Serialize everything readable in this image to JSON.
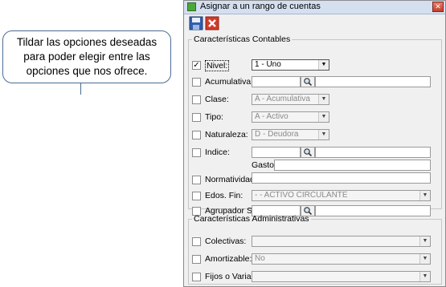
{
  "callout": {
    "text": "Tildar las opciones deseadas para poder elegir entre las opciones que nos ofrece."
  },
  "window": {
    "title": "Asignar a un rango de cuentas"
  },
  "contables": {
    "legend": "Características Contables",
    "nivel": {
      "label": "Nivel:",
      "checked": true,
      "value": "1 - Uno"
    },
    "acumulativa": {
      "label": "Acumulativa:"
    },
    "clase": {
      "label": "Clase:",
      "value": "A - Acumulativa"
    },
    "tipo": {
      "label": "Tipo:",
      "value": "A - Activo"
    },
    "naturaleza": {
      "label": "Naturaleza:",
      "value": "D - Deudora"
    },
    "indice": {
      "label": "Indice:",
      "gasto_label": "Gasto:"
    },
    "normatividad": {
      "label": "Normatividad:"
    },
    "edos_fin": {
      "label": "Edos. Fin:",
      "value": "- - ACTIVO CIRCULANTE"
    },
    "agrupador": {
      "label": "Agrupador SAT:"
    }
  },
  "administrativas": {
    "legend": "Características Administrativas",
    "colectivas": {
      "label": "Colectivas:",
      "value": ""
    },
    "amortizable": {
      "label": "Amortizable:",
      "value": "No"
    },
    "fijos": {
      "label": "Fijos o Variables:",
      "value": ""
    }
  }
}
